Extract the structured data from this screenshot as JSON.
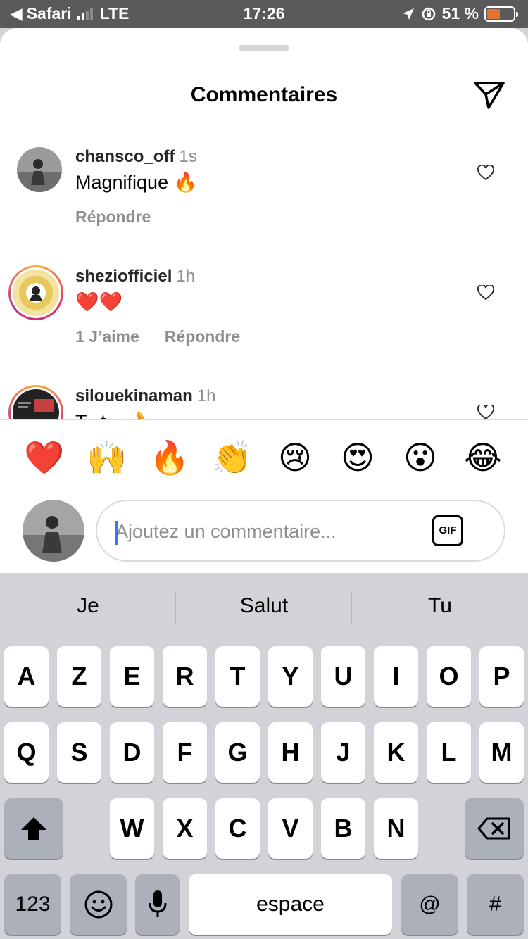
{
  "status_bar": {
    "back_app": "Safari",
    "carrier": "LTE",
    "time": "17:26",
    "battery_percent": "51 %",
    "battery_level": 0.51
  },
  "sheet": {
    "title": "Commentaires"
  },
  "comments": [
    {
      "username": "chansco_off",
      "time": "1s",
      "text": "Magnifique 🔥",
      "likes": "",
      "reply": "Répondre"
    },
    {
      "username": "sheziofficiel",
      "time": "1h",
      "text": "❤️❤️",
      "likes": "1 J’aime",
      "reply": "Répondre"
    },
    {
      "username": "silouekinaman",
      "time": "1h",
      "text": "T...t... 👌",
      "likes": "",
      "reply": ""
    }
  ],
  "emoji_bar": [
    "❤️",
    "🙌",
    "🔥",
    "👏",
    "😢",
    "😍",
    "😮",
    "😂"
  ],
  "composer": {
    "placeholder": "Ajoutez un commentaire...",
    "gif_label": "GIF"
  },
  "keyboard": {
    "suggestions": [
      "Je",
      "Salut",
      "Tu"
    ],
    "row1": [
      "A",
      "Z",
      "E",
      "R",
      "T",
      "Y",
      "U",
      "I",
      "O",
      "P"
    ],
    "row2": [
      "Q",
      "S",
      "D",
      "F",
      "G",
      "H",
      "J",
      "K",
      "L",
      "M"
    ],
    "row3": [
      "W",
      "X",
      "C",
      "V",
      "B",
      "N"
    ],
    "numbers_label": "123",
    "space_label": "espace",
    "at_label": "@",
    "hash_label": "#"
  },
  "colors": {
    "accent_caret": "#3478f6",
    "secondary_text": "#8e8e8e",
    "battery_fill": "#e0732d"
  }
}
